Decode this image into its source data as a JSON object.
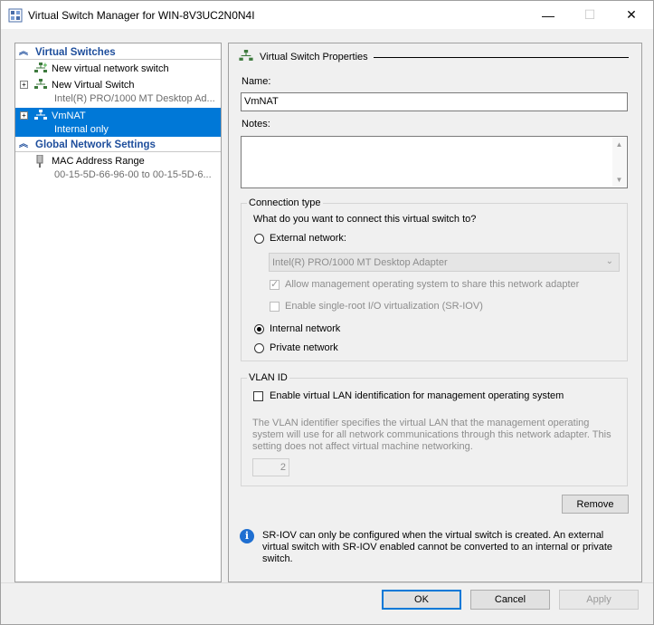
{
  "window": {
    "title": "Virtual Switch Manager for WIN-8V3UC2N0N4I",
    "minimize_glyph": "—",
    "maximize_glyph": "☐",
    "close_glyph": "✕"
  },
  "tree": {
    "virtual_switches_header": "Virtual Switches",
    "items": [
      {
        "line1": "New virtual network switch",
        "icon": "new-switch-icon"
      },
      {
        "line1": "New Virtual Switch",
        "line2": "Intel(R) PRO/1000 MT Desktop Ad...",
        "icon": "network-switch-icon"
      },
      {
        "line1": "VmNAT",
        "line2": "Internal only",
        "icon": "network-switch-icon",
        "selected": true
      }
    ],
    "global_header": "Global Network Settings",
    "global_items": [
      {
        "line1": "MAC Address Range",
        "line2": "00-15-5D-66-96-00 to 00-15-5D-6...",
        "icon": "mac-address-icon"
      }
    ]
  },
  "props": {
    "section_title": "Virtual Switch Properties",
    "name_label": "Name:",
    "name_value": "VmNAT",
    "notes_label": "Notes:",
    "notes_value": "",
    "connection_type": {
      "group_title": "Connection type",
      "question": "What do you want to connect this virtual switch to?",
      "external_label": "External network:",
      "adapter_value": "Intel(R) PRO/1000 MT Desktop Adapter",
      "allow_mgmt_label": "Allow management operating system to share this network adapter",
      "sriov_label": "Enable single-root I/O virtualization (SR-IOV)",
      "internal_label": "Internal network",
      "private_label": "Private network",
      "selected": "internal"
    },
    "vlan": {
      "group_title": "VLAN ID",
      "enable_label": "Enable virtual LAN identification for management operating system",
      "description": "The VLAN identifier specifies the virtual LAN that the management operating system will use for all network communications through this network adapter. This setting does not affect virtual machine networking.",
      "vlan_value": "2"
    },
    "remove_label": "Remove",
    "info_text": "SR-IOV can only be configured when the virtual switch is created. An external virtual switch with SR-IOV enabled cannot be converted to an internal or private switch."
  },
  "footer": {
    "ok_label": "OK",
    "cancel_label": "Cancel",
    "apply_label": "Apply"
  },
  "colors": {
    "selection": "#0078d7",
    "header_text": "#1e4e9c",
    "info_icon": "#1f6fd1"
  }
}
